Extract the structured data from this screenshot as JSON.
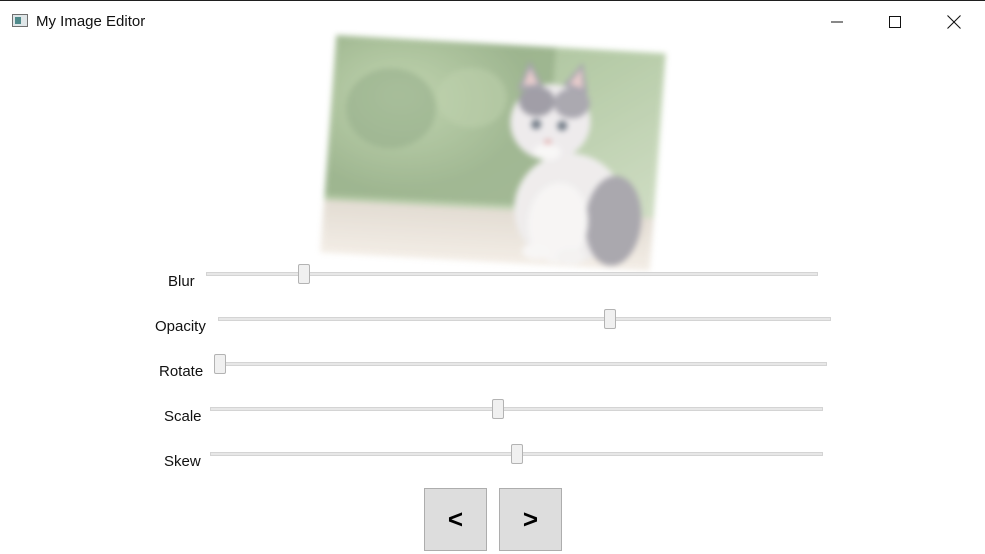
{
  "window": {
    "title": "My Image Editor",
    "app_icon": "window-app-icon",
    "controls": [
      "minimize-icon",
      "maximize-icon",
      "close-icon"
    ]
  },
  "image": {
    "subject": "kitten photo",
    "effects": {
      "blur": "applied",
      "opacity": "reduced",
      "rotate": "slight",
      "skew": "slight"
    }
  },
  "sliders": [
    {
      "label": "Blur",
      "value": 0.16
    },
    {
      "label": "Opacity",
      "value": 0.64
    },
    {
      "label": "Rotate",
      "value": 0.01
    },
    {
      "label": "Scale",
      "value": 0.47
    },
    {
      "label": "Skew",
      "value": 0.5
    }
  ],
  "nav": {
    "prev_label": "<",
    "next_label": ">"
  },
  "colors": {
    "window_bg": "#ffffff",
    "button_bg": "#dddddd",
    "slider_track": "#e7e7e7"
  }
}
